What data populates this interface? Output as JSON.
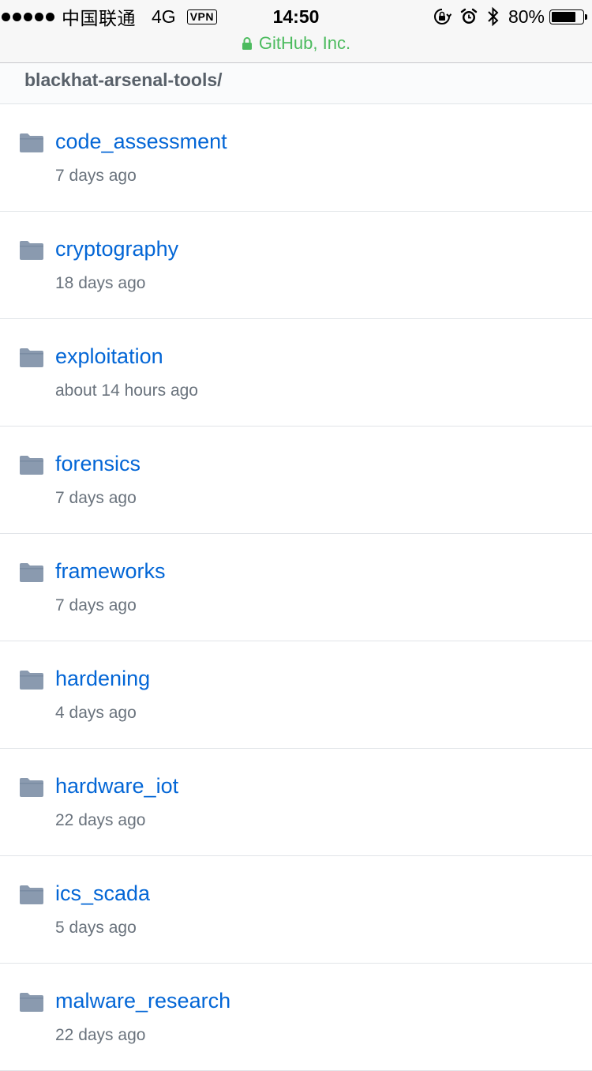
{
  "status_bar": {
    "carrier": "中国联通",
    "network": "4G",
    "vpn": "VPN",
    "time": "14:50",
    "battery": "80%",
    "battery_level": 0.8
  },
  "url_bar": {
    "site": "GitHub, Inc."
  },
  "breadcrumb": {
    "path": "blackhat-arsenal-tools/"
  },
  "folders": [
    {
      "name": "code_assessment",
      "age": "7 days ago"
    },
    {
      "name": "cryptography",
      "age": "18 days ago"
    },
    {
      "name": "exploitation",
      "age": "about 14 hours ago"
    },
    {
      "name": "forensics",
      "age": "7 days ago"
    },
    {
      "name": "frameworks",
      "age": "7 days ago"
    },
    {
      "name": "hardening",
      "age": "4 days ago"
    },
    {
      "name": "hardware_iot",
      "age": "22 days ago"
    },
    {
      "name": "ics_scada",
      "age": "5 days ago"
    },
    {
      "name": "malware_research",
      "age": "22 days ago"
    }
  ],
  "icons": {
    "folder": "folder-icon",
    "lock": "lock-icon",
    "orientation_lock": "orientation-lock-icon",
    "alarm": "alarm-icon",
    "bluetooth": "bluetooth-icon"
  },
  "colors": {
    "link": "#0366d6",
    "meta": "#6a737d",
    "folder_icon": "#8a9aaf",
    "secure_green": "#4cbb5e"
  }
}
